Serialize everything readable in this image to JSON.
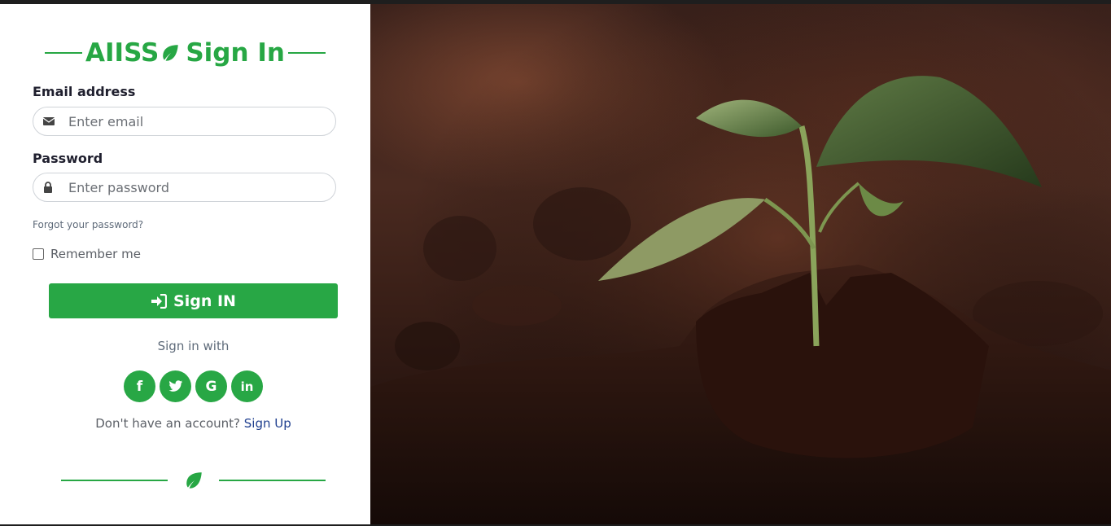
{
  "brand": {
    "title_prefix": "AIISS",
    "title_suffix": "Sign In",
    "accent": "#27a744"
  },
  "form": {
    "email_label": "Email address",
    "email_placeholder": "Enter email",
    "email_icon": "envelope-icon",
    "password_label": "Password",
    "password_placeholder": "Enter password",
    "password_icon": "lock-icon",
    "forgot_link": "Forgot your password?",
    "remember_label": "Remember me",
    "remember_checked": false,
    "submit_label": "Sign IN",
    "submit_icon": "sign-in-icon"
  },
  "social": {
    "heading": "Sign in with",
    "buttons": [
      {
        "icon": "facebook-icon",
        "glyph": "f"
      },
      {
        "icon": "twitter-icon",
        "glyph": ""
      },
      {
        "icon": "google-icon",
        "glyph": "G"
      },
      {
        "icon": "linkedin-icon",
        "glyph": "in"
      }
    ]
  },
  "signup": {
    "prompt": "Don't have an account?",
    "link": "Sign Up"
  },
  "hero": {
    "subject": "seedling-in-soil-image"
  }
}
